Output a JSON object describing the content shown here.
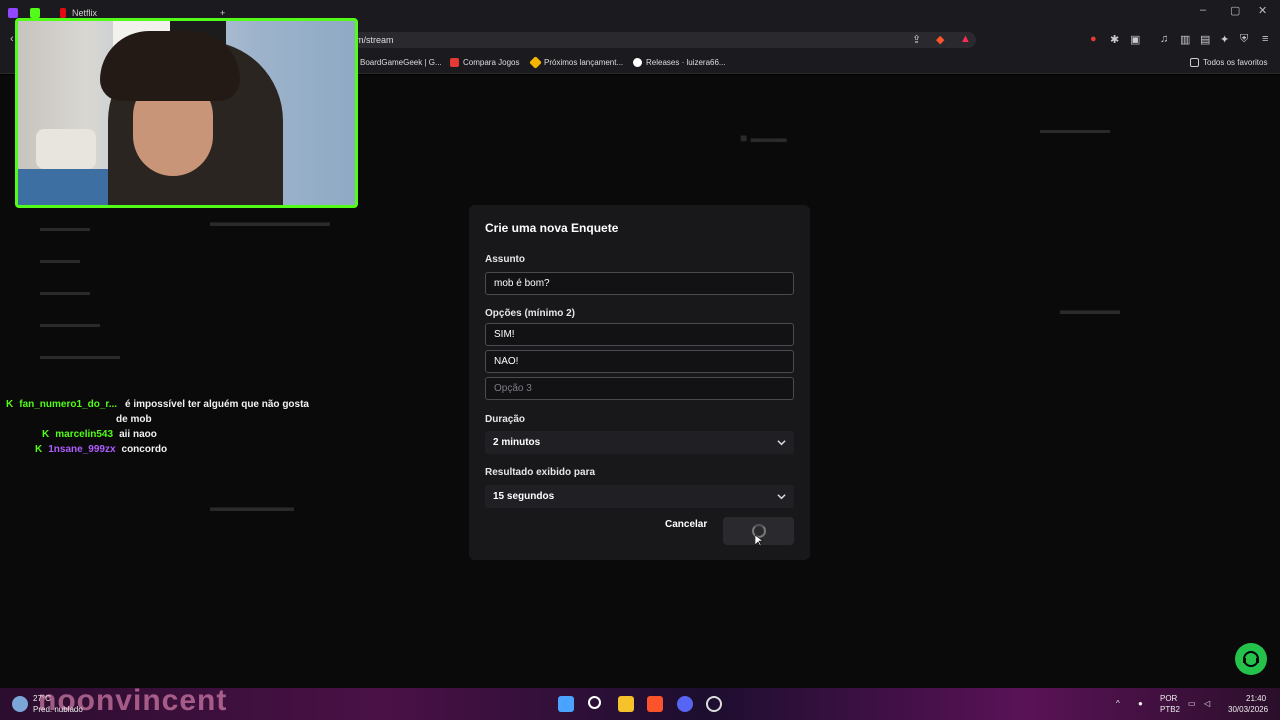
{
  "browser": {
    "tabs": [
      {
        "label": "Netflix"
      }
    ],
    "new_tab_symbol": "+",
    "url": "m/stream",
    "bookmarks": [
      {
        "label": "BoardGameGeek | G..."
      },
      {
        "label": "Compara Jogos"
      },
      {
        "label": "Próximos lançament..."
      },
      {
        "label": "Releases · luizera66..."
      }
    ],
    "all_favorites": "Todos os favoritos"
  },
  "chat": [
    {
      "user": "fan_numero1_do_r...",
      "message": "é impossível ter alguém que não gosta",
      "message2": "de mob",
      "user_color": "#53fc18"
    },
    {
      "user": "marcelin543",
      "message": "aii naoo",
      "user_color": "#53fc18"
    },
    {
      "user": "1nsane_999zx",
      "message": "concordo",
      "user_color": "#b05cff"
    }
  ],
  "modal": {
    "title": "Crie uma nova Enquete",
    "subject_label": "Assunto",
    "subject_value": "mob é bom?",
    "options_label": "Opções (mínimo 2)",
    "option1": "SIM!",
    "option2": "NÃO!",
    "option3_placeholder": "Opção 3",
    "duration_label": "Duração",
    "duration_value": "2 minutos",
    "result_label": "Resultado exibido para",
    "result_value": "15 segundos",
    "cancel_label": "Cancelar"
  },
  "taskbar": {
    "weather_temp": "27°C",
    "weather_desc": "Pred. nublado",
    "lang": "POR",
    "layout": "PTB2",
    "time": "21:40",
    "date": "30/03/2026",
    "overlay_name": "noonvincent"
  },
  "colors": {
    "accent": "#53fc18",
    "modal_bg": "#18181b"
  }
}
